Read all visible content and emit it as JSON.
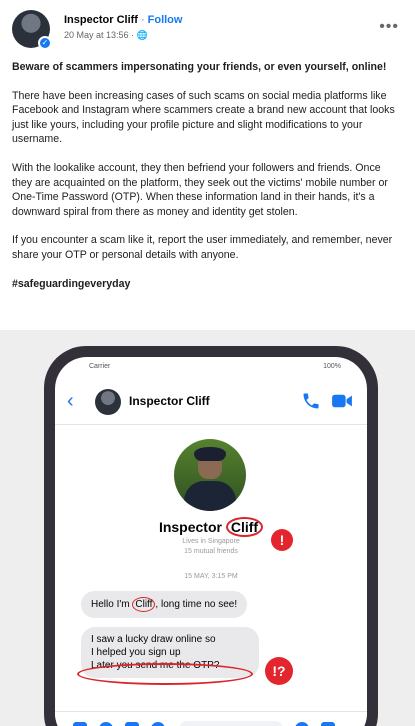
{
  "post": {
    "author": "Inspector Cliff",
    "follow_label": "Follow",
    "timestamp": "20 May at 13:56",
    "audience_icon": "globe-icon",
    "more_label": "•••",
    "paragraphs": [
      "Beware of scammers impersonating your friends, or even yourself, online!",
      "There have been increasing cases of such scams on social media platforms like Facebook and Instagram where scammers create a brand new account that looks just like yours, including your profile picture and slight modifications to your username.",
      "With the lookalike account, they then befriend your followers and friends. Once they are acquainted on the platform, they seek out the victims' mobile number or One-Time Password (OTP). When these information land in their hands, it's a downward spiral from there as money and identity get stolen.",
      "If you encounter a scam like it, report the user immediately, and remember, never share your OTP or personal details with anyone."
    ],
    "hashtag": "#safeguardingeveryday"
  },
  "phone": {
    "carrier": "Carrier",
    "battery": "100%",
    "chat_name": "Inspector Cliff",
    "profile_name_prefix": "Inspector ",
    "profile_name_ring": "Cliff",
    "profile_sub_1": "Lives in Singapore",
    "profile_sub_2": "15 mutual friends",
    "chat_time": "15 MAY, 3:15 PM",
    "alert1": "!",
    "alert2": "!?",
    "msg1_pre": "Hello I'm ",
    "msg1_ring": "Cliff",
    "msg1_post": ", long time no see!",
    "msg2_lines": [
      "I saw a lucky draw online so",
      "I helped you sign up",
      "Later you send me the OTP?"
    ]
  },
  "colors": {
    "accent": "#1877f2",
    "alert": "#e3262e",
    "phone_frame": "#34303a"
  }
}
